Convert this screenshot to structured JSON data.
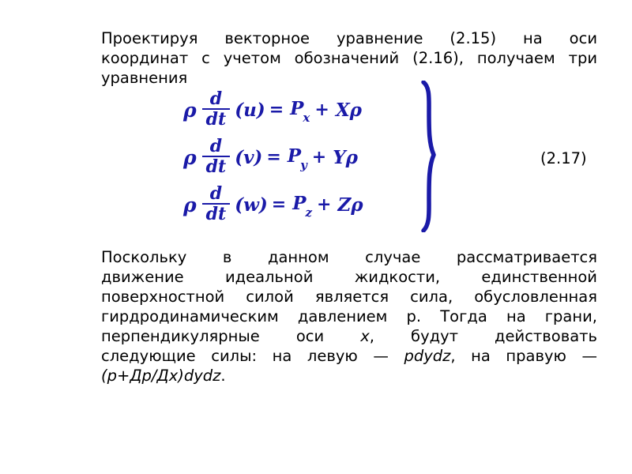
{
  "slide": {
    "background_color": "#ffffff",
    "text_color": "#000000",
    "equation_color": "#1a1aa8"
  },
  "paragraph1": {
    "full_text": "Проектируя векторное уравнение (2.15) на оси координат с учетом обозначений (2.16), получаем три уравнения",
    "lines": [
      "Проектируя  векторное  уравнение  (2.15)  на  оси",
      "координат с учетом обозначений (2.16), получаем три",
      "уравнения"
    ]
  },
  "equations": {
    "number": "(2.17)",
    "rows": [
      {
        "rho": "ρ",
        "frac_num": "d",
        "frac_den": "dt",
        "variable": "(u)",
        "equals": "=",
        "p_letter": "P",
        "p_sub": "x",
        "plus": "+",
        "force_letter": "X",
        "force_rho": "ρ"
      },
      {
        "rho": "ρ",
        "frac_num": "d",
        "frac_den": "dt",
        "variable": "(v)",
        "equals": "=",
        "p_letter": "P",
        "p_sub": "y",
        "plus": "+",
        "force_letter": "Y",
        "force_rho": "ρ"
      },
      {
        "rho": "ρ",
        "frac_num": "d",
        "frac_den": "dt",
        "variable": "(w)",
        "equals": "=",
        "p_letter": "P",
        "p_sub": "z",
        "plus": "+",
        "force_letter": "Z",
        "force_rho": "ρ"
      }
    ]
  },
  "paragraph2": {
    "full_text": "Поскольку в данном случае рассматривается движение идеальной  жидкости, единственной поверхностной силой является сила, обусловленная  гирдродинамическим давлением p. Тогда на грани, перпендикулярные оси x, будут действовать следующие силы: на левую — pdydz, на правую — (p+Дp/Дx)dydz.",
    "lines": [
      {
        "segments": [
          {
            "text": "Поскольку  в  данном  случае  рассматривается",
            "italic": false
          }
        ]
      },
      {
        "segments": [
          {
            "text": "движение  идеальной    жидкости,  единственной",
            "italic": false
          }
        ]
      },
      {
        "segments": [
          {
            "text": "поверхностной  силой является  сила,  обусловленная",
            "italic": false
          }
        ]
      },
      {
        "segments": [
          {
            "text": " гирдродинамическим давлением p. Тогда  на  грани,",
            "italic": false
          }
        ]
      },
      {
        "segments": [
          {
            "text": "перпендикулярные     оси    ",
            "italic": false
          },
          {
            "text": "x",
            "italic": true
          },
          {
            "text": ",     будут    действовать",
            "italic": false
          }
        ]
      },
      {
        "segments": [
          {
            "text": "следующие силы: на левую — ",
            "italic": false
          },
          {
            "text": "pdydz",
            "italic": true
          },
          {
            "text": ", на правую  —",
            "italic": false
          }
        ]
      },
      {
        "segments": [
          {
            "text": "(p+Дp/Дx)dydz",
            "italic": true
          },
          {
            "text": ".",
            "italic": false
          }
        ]
      }
    ]
  }
}
